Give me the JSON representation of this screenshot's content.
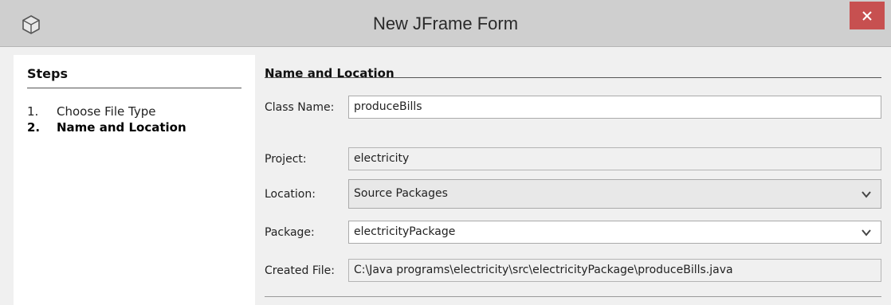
{
  "window": {
    "title": "New JFrame Form",
    "close_icon": "close-icon",
    "app_icon": "netbeans-cube-icon"
  },
  "steps": {
    "title": "Steps",
    "items": [
      {
        "number": "1.",
        "label": "Choose File Type",
        "current": false
      },
      {
        "number": "2.",
        "label": "Name and Location",
        "current": true
      }
    ]
  },
  "form": {
    "section_title": "Name and Location",
    "class_name": {
      "label": "Class Name:",
      "value": "produceBills"
    },
    "project": {
      "label": "Project:",
      "value": "electricity"
    },
    "location": {
      "label": "Location:",
      "value": "Source Packages"
    },
    "package": {
      "label": "Package:",
      "value": "electricityPackage"
    },
    "created_file": {
      "label": "Created File:",
      "value": "C:\\Java programs\\electricity\\src\\electricityPackage\\produceBills.java"
    }
  },
  "colors": {
    "title_bar": "#cfcfcf",
    "close_button": "#c75050",
    "dialog_background": "#f0f0f0"
  }
}
